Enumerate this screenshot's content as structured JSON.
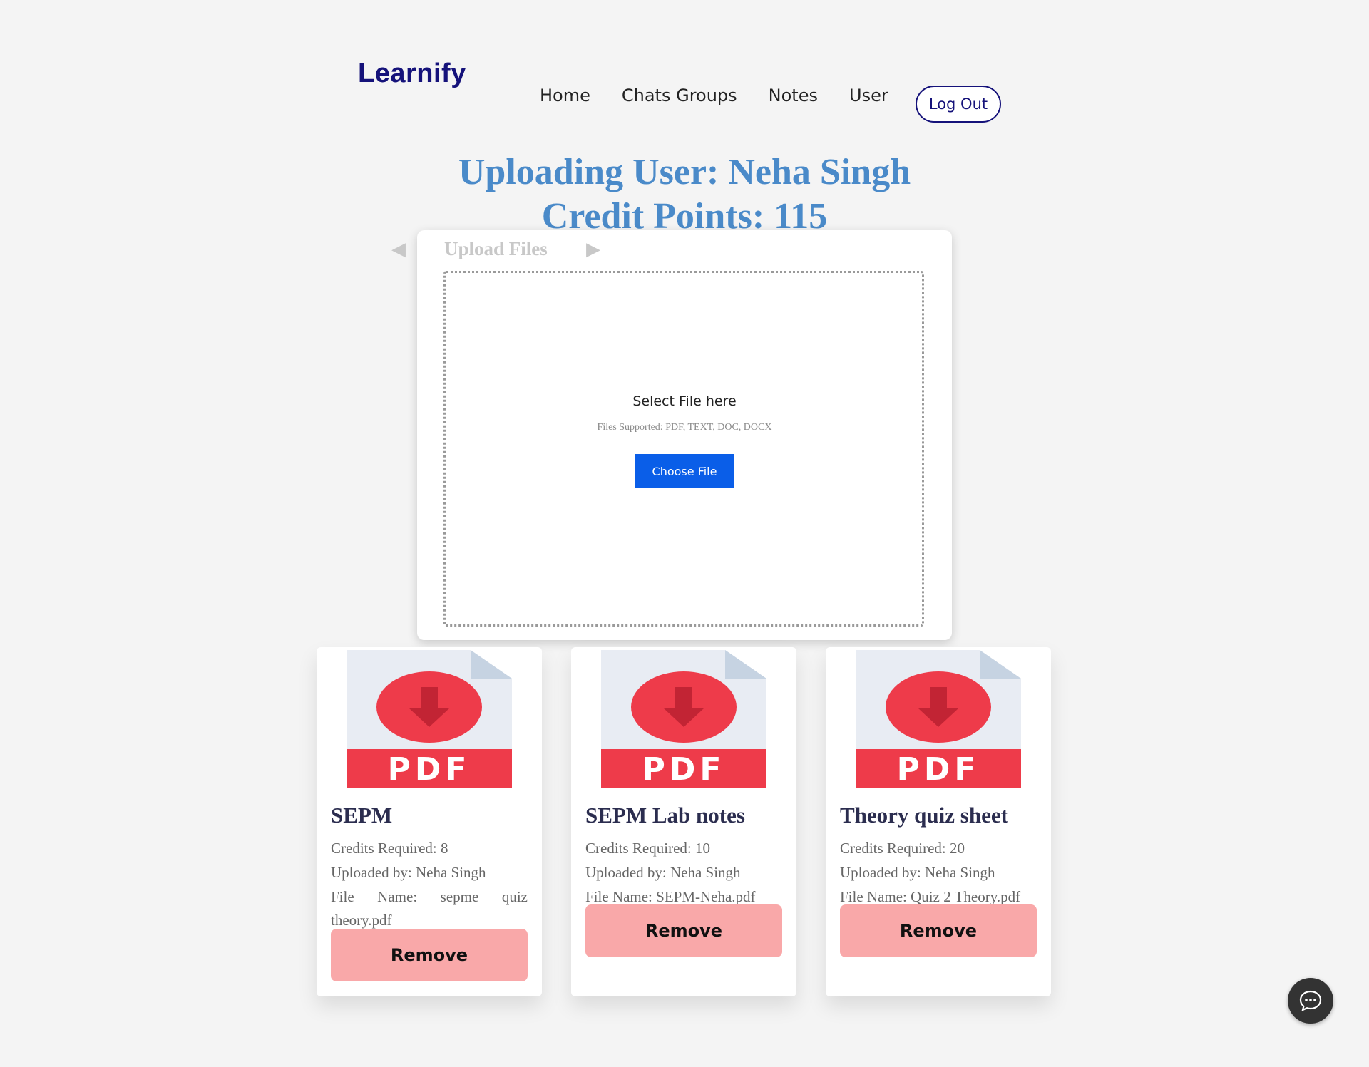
{
  "header": {
    "logo": "Learnify",
    "nav": [
      "Home",
      "Chats Groups",
      "Notes",
      "User"
    ],
    "logout_label": "Log Out"
  },
  "heading": {
    "user_line": "Uploading User: Neha Singh",
    "credits_line": "Credit Points: 115"
  },
  "upload": {
    "title": "Upload Files",
    "prev_arrow": "◀",
    "next_arrow": "▶",
    "select_label": "Select File here",
    "supported": "Files Supported: PDF, TEXT, DOC, DOCX",
    "choose_label": "Choose File"
  },
  "notes": [
    {
      "title": "SEPM",
      "credits": "Credits Required: 8",
      "uploader": "Uploaded by: Neha Singh",
      "file": "File Name: sepme quiz theory.pdf",
      "remove_label": "Remove"
    },
    {
      "title": "SEPM Lab notes",
      "credits": "Credits Required: 10",
      "uploader": "Uploaded by: Neha Singh",
      "file": "File Name: SEPM-Neha.pdf",
      "remove_label": "Remove"
    },
    {
      "title": "Theory quiz sheet",
      "credits": "Credits Required: 20",
      "uploader": "Uploaded by: Neha Singh",
      "file": "File Name: Quiz 2 Theory.pdf",
      "remove_label": "Remove"
    }
  ],
  "pdf_icon_label": "PDF",
  "icons": {
    "pdf": "pdf-download-icon",
    "chat": "chat-bubble-icon"
  },
  "colors": {
    "brand": "#15127a",
    "heading": "#4a8ac9",
    "primary_button": "#0a5ee8",
    "remove_button": "#f9a8a9",
    "pdf_red": "#ee3b4a"
  }
}
